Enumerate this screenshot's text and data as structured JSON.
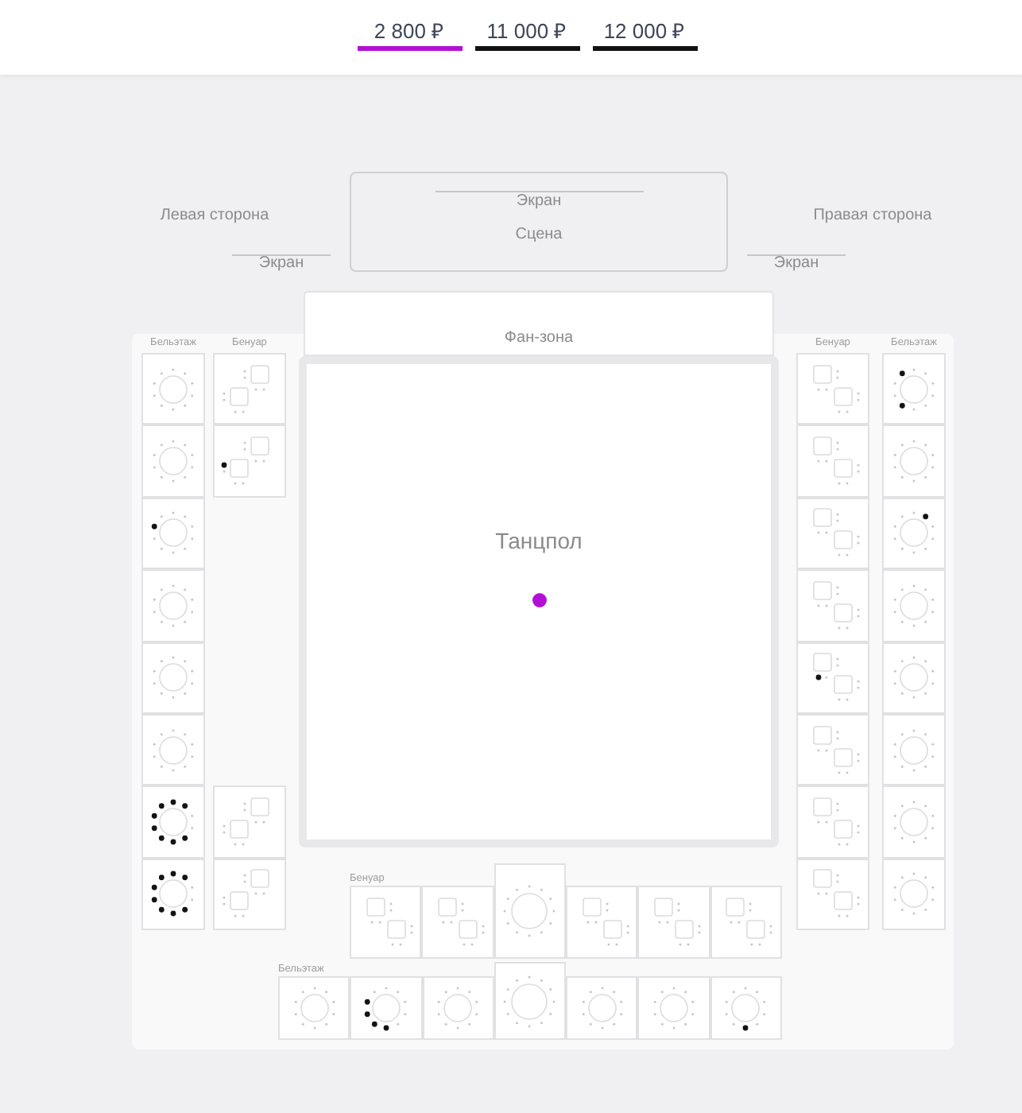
{
  "price_tabs": [
    {
      "label": "2 800 ₽",
      "color": "#b30fd6"
    },
    {
      "label": "11 000 ₽",
      "color": "#111111"
    },
    {
      "label": "12 000 ₽",
      "color": "#111111"
    }
  ],
  "left_side": {
    "label": "Левая сторона",
    "screen": "Экран"
  },
  "stage": {
    "screen": "Экран",
    "label": "Сцена"
  },
  "right_side": {
    "label": "Правая сторона",
    "screen": "Экран"
  },
  "fan_zone": {
    "label": "Фан-зона"
  },
  "dance_floor": {
    "label": "Танцпол",
    "color": "#b30fd6"
  },
  "left": {
    "balcony": {
      "label": "Бельэтаж",
      "tables": [
        {
          "kind": "round",
          "seats": [
            false,
            false,
            false,
            false,
            false,
            false,
            false,
            false,
            false,
            false
          ]
        },
        {
          "kind": "round",
          "seats": [
            false,
            false,
            false,
            false,
            false,
            false,
            false,
            false,
            false,
            false
          ]
        },
        {
          "kind": "round",
          "seats": [
            false,
            false,
            false,
            false,
            false,
            false,
            false,
            false,
            true,
            false
          ]
        },
        {
          "kind": "round",
          "seats": [
            false,
            false,
            false,
            false,
            false,
            false,
            false,
            false,
            false,
            false
          ]
        },
        {
          "kind": "round",
          "seats": [
            false,
            false,
            false,
            false,
            false,
            false,
            false,
            false,
            false,
            false
          ]
        },
        {
          "kind": "round",
          "seats": [
            false,
            false,
            false,
            false,
            false,
            false,
            false,
            false,
            false,
            false
          ]
        },
        {
          "kind": "round",
          "seats": [
            true,
            true,
            false,
            false,
            true,
            true,
            true,
            true,
            true,
            true
          ]
        },
        {
          "kind": "round",
          "seats": [
            true,
            true,
            false,
            false,
            true,
            true,
            true,
            true,
            true,
            true
          ]
        }
      ]
    },
    "benoir": {
      "label": "Бенуар",
      "groups": [
        {
          "tables": [
            {
              "kind": "pair",
              "seats": [
                false,
                false,
                false,
                false,
                false,
                false,
                false,
                false
              ]
            },
            {
              "kind": "pair",
              "seats": [
                false,
                false,
                false,
                false,
                true,
                false,
                false,
                false
              ]
            }
          ]
        },
        {
          "tables": [
            {
              "kind": "pair",
              "seats": [
                false,
                false,
                false,
                false,
                false,
                false,
                false,
                false
              ]
            },
            {
              "kind": "pair",
              "seats": [
                false,
                false,
                false,
                false,
                false,
                false,
                false,
                false
              ]
            }
          ]
        }
      ]
    }
  },
  "right": {
    "benoir": {
      "label": "Бенуар",
      "tables": [
        {
          "kind": "pair",
          "seats": [
            false,
            false,
            false,
            false,
            false,
            false,
            false,
            false
          ]
        },
        {
          "kind": "pair",
          "seats": [
            false,
            false,
            false,
            false,
            false,
            false,
            false,
            false
          ]
        },
        {
          "kind": "pair",
          "seats": [
            false,
            false,
            false,
            false,
            false,
            false,
            false,
            false
          ]
        },
        {
          "kind": "pair",
          "seats": [
            false,
            false,
            false,
            false,
            false,
            false,
            false,
            false
          ]
        },
        {
          "kind": "pair",
          "seats": [
            false,
            false,
            false,
            true,
            false,
            false,
            false,
            false
          ]
        },
        {
          "kind": "pair",
          "seats": [
            false,
            false,
            false,
            false,
            false,
            false,
            false,
            false
          ]
        },
        {
          "kind": "pair",
          "seats": [
            false,
            false,
            false,
            false,
            false,
            false,
            false,
            false
          ]
        },
        {
          "kind": "pair",
          "seats": [
            false,
            false,
            false,
            false,
            false,
            false,
            false,
            false
          ]
        }
      ]
    },
    "balcony": {
      "label": "Бельэтаж",
      "tables": [
        {
          "kind": "round",
          "seats": [
            false,
            false,
            false,
            false,
            false,
            false,
            true,
            false,
            false,
            true
          ]
        },
        {
          "kind": "round",
          "seats": [
            false,
            false,
            false,
            false,
            false,
            false,
            false,
            false,
            false,
            false
          ]
        },
        {
          "kind": "round",
          "seats": [
            false,
            true,
            false,
            false,
            false,
            false,
            false,
            false,
            false,
            false
          ]
        },
        {
          "kind": "round",
          "seats": [
            false,
            false,
            false,
            false,
            false,
            false,
            false,
            false,
            false,
            false
          ]
        },
        {
          "kind": "round",
          "seats": [
            false,
            false,
            false,
            false,
            false,
            false,
            false,
            false,
            false,
            false
          ]
        },
        {
          "kind": "round",
          "seats": [
            false,
            false,
            false,
            false,
            false,
            false,
            false,
            false,
            false,
            false
          ]
        },
        {
          "kind": "round",
          "seats": [
            false,
            false,
            false,
            false,
            false,
            false,
            false,
            false,
            false,
            false
          ]
        },
        {
          "kind": "round",
          "seats": [
            false,
            false,
            false,
            false,
            false,
            false,
            false,
            false,
            false,
            false
          ]
        }
      ]
    }
  },
  "bottom": {
    "benoir": {
      "label": "Бенуар",
      "tables": [
        {
          "kind": "pair",
          "seats": [
            false,
            false,
            false,
            false,
            false,
            false,
            false,
            false
          ]
        },
        {
          "kind": "pair",
          "seats": [
            false,
            false,
            false,
            false,
            false,
            false,
            false,
            false
          ]
        },
        {
          "kind": "large-round",
          "seats": [
            false,
            false,
            false,
            false,
            false,
            false,
            false,
            false,
            false,
            false,
            false,
            false
          ]
        },
        {
          "kind": "pair",
          "seats": [
            false,
            false,
            false,
            false,
            false,
            false,
            false,
            false
          ]
        },
        {
          "kind": "pair",
          "seats": [
            false,
            false,
            false,
            false,
            false,
            false,
            false,
            false
          ]
        },
        {
          "kind": "pair",
          "seats": [
            false,
            false,
            false,
            false,
            false,
            false,
            false,
            false
          ]
        }
      ]
    },
    "balcony": {
      "label": "Бельэтаж",
      "tables": [
        {
          "kind": "round",
          "seats": [
            false,
            false,
            false,
            false,
            false,
            false,
            false,
            false,
            false,
            false
          ]
        },
        {
          "kind": "round",
          "seats": [
            false,
            false,
            false,
            false,
            false,
            true,
            true,
            true,
            true,
            false
          ]
        },
        {
          "kind": "round",
          "seats": [
            false,
            false,
            false,
            false,
            false,
            false,
            false,
            false,
            false,
            false
          ]
        },
        {
          "kind": "large-round",
          "seats": [
            false,
            false,
            false,
            false,
            false,
            false,
            false,
            false,
            false,
            false,
            false,
            false
          ]
        },
        {
          "kind": "round",
          "seats": [
            false,
            false,
            false,
            false,
            false,
            false,
            false,
            false,
            false,
            false
          ]
        },
        {
          "kind": "round",
          "seats": [
            false,
            false,
            false,
            false,
            false,
            false,
            false,
            false,
            false,
            false
          ]
        },
        {
          "kind": "round",
          "seats": [
            false,
            false,
            false,
            false,
            false,
            true,
            false,
            false,
            false,
            false
          ]
        }
      ]
    }
  }
}
